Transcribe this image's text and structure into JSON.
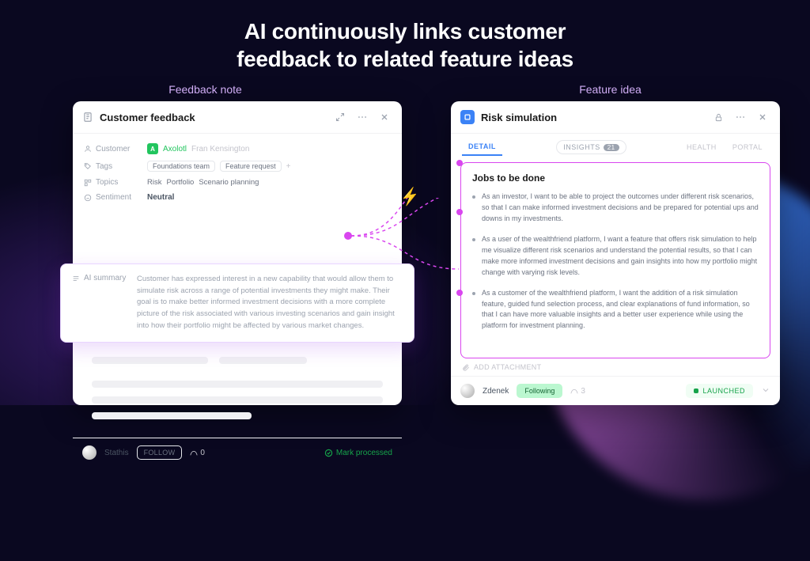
{
  "headline": "AI continuously links customer\nfeedback to related feature ideas",
  "labels": {
    "left": "Feedback note",
    "right": "Feature idea"
  },
  "left": {
    "title": "Customer feedback",
    "meta": {
      "customer_label": "Customer",
      "company_short": "A",
      "company": "Axolotl",
      "person": "Fran Kensington",
      "tags_label": "Tags",
      "tags": [
        "Foundations team",
        "Feature request"
      ],
      "topics_label": "Topics",
      "topics": [
        "Risk",
        "Portfolio",
        "Scenario planning"
      ],
      "sentiment_label": "Sentiment",
      "sentiment": "Neutral"
    },
    "summary_label": "AI summary",
    "summary": "Customer has expressed interest in a new capability that would allow them to simulate risk across a range of potential investments they might make. Their goal is to make better informed investment decisions with a more complete picture of the risk associated with various investing scenarios and gain insight into how their portfolio might be affected by various market changes.",
    "footer": {
      "author": "Stathis",
      "follow": "FOLLOW",
      "signal": "0",
      "mark_processed": "Mark processed"
    }
  },
  "right": {
    "title": "Risk simulation",
    "tabs": {
      "detail": "DETAIL",
      "insights": "INSIGHTS",
      "insights_count": "21",
      "health": "HEALTH",
      "portal": "PORTAL"
    },
    "jtbd_title": "Jobs to be done",
    "jobs": [
      "As an investor, I want to be able to project the outcomes under different risk scenarios, so that I can make informed investment decisions and be prepared for potential ups and downs in my investments.",
      "As a user of the wealthfriend platform, I want a feature that offers risk simulation to help me visualize different risk scenarios and understand the potential results, so that I can make more informed investment decisions and gain insights into how my portfolio might change with varying risk levels.",
      "As a customer of the wealthfriend platform, I want the addition of a risk simulation feature, guided fund selection process, and clear explanations of fund information, so that I can have more valuable insights and a better user experience while using the platform for investment planning."
    ],
    "attach": "ADD ATTACHMENT",
    "footer": {
      "author": "Zdenek",
      "following": "Following",
      "signal": "3",
      "status": "LAUNCHED"
    }
  }
}
